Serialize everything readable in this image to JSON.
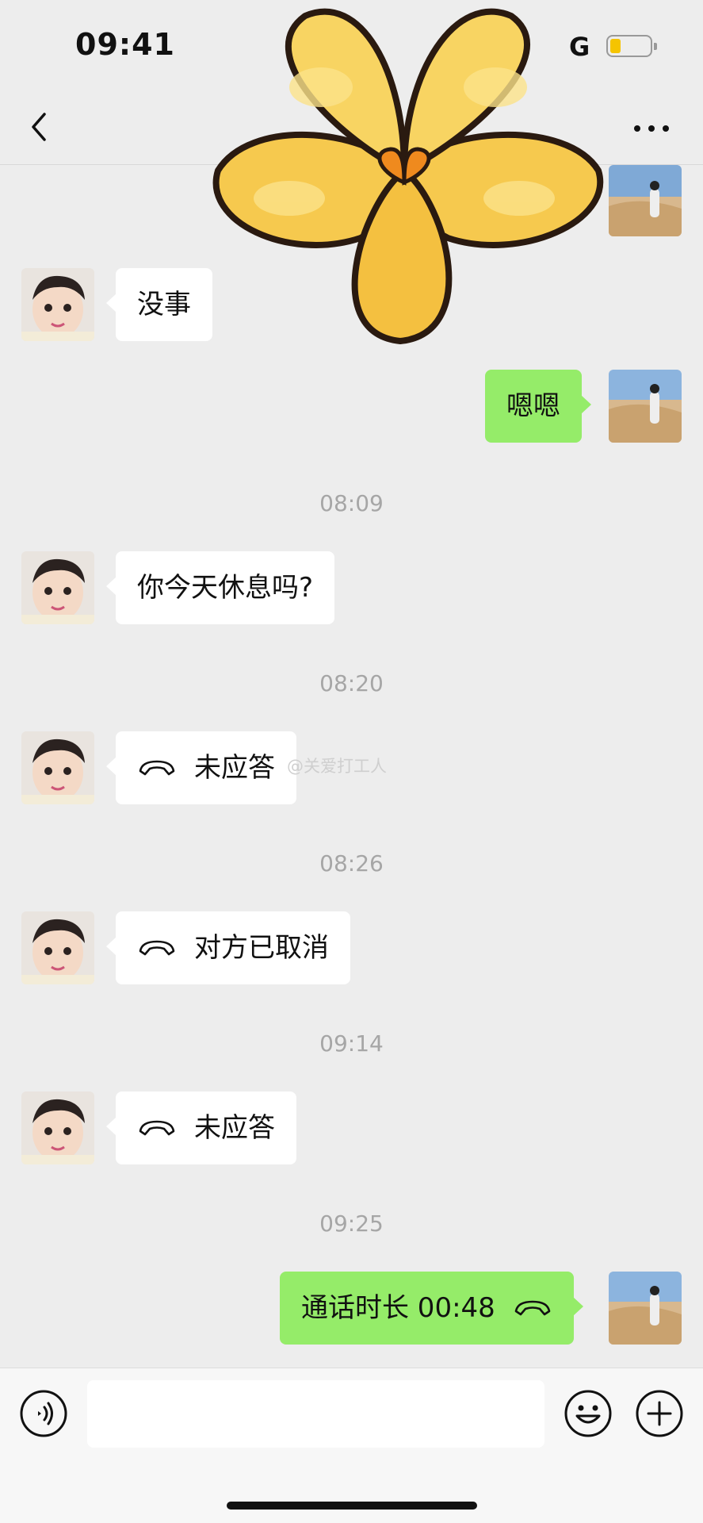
{
  "status_bar": {
    "time": "09:41",
    "network": "G"
  },
  "watermark": "@关爱打工人",
  "messages": [
    {
      "type": "text",
      "from": "contact",
      "text": "没事"
    },
    {
      "type": "text",
      "from": "me",
      "text": "嗯嗯"
    },
    {
      "type": "timestamp",
      "text": "08:09"
    },
    {
      "type": "text",
      "from": "contact",
      "text": "你今天休息吗?"
    },
    {
      "type": "timestamp",
      "text": "08:20"
    },
    {
      "type": "call",
      "from": "contact",
      "text": "未应答"
    },
    {
      "type": "timestamp",
      "text": "08:26"
    },
    {
      "type": "call",
      "from": "contact",
      "text": "对方已取消"
    },
    {
      "type": "timestamp",
      "text": "09:14"
    },
    {
      "type": "call",
      "from": "contact",
      "text": "未应答"
    },
    {
      "type": "timestamp",
      "text": "09:25"
    },
    {
      "type": "call",
      "from": "me",
      "text": "通话时长 00:48"
    }
  ],
  "icons": {
    "back": "chevron-left-icon",
    "more": "more-dots-icon",
    "call": "phone-hangup-icon",
    "voice": "voice-icon",
    "emoji": "emoji-icon",
    "plus": "plus-icon",
    "sticker": "flower-sticker"
  },
  "colors": {
    "background": "#ededed",
    "outgoing_bubble": "#95ec69",
    "incoming_bubble": "#ffffff",
    "timestamp": "#a6a6a6",
    "battery_level": "#f5c400"
  },
  "battery_level": 0.25
}
